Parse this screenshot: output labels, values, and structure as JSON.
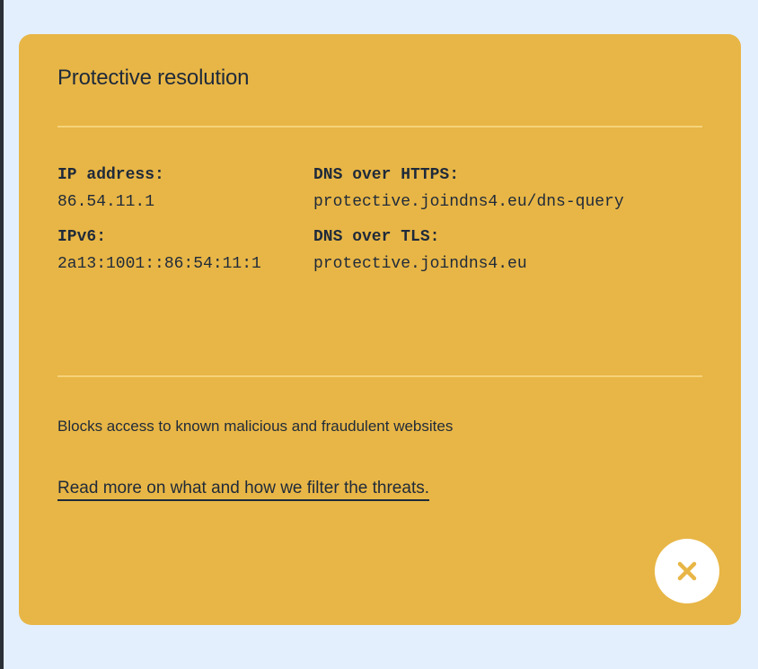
{
  "card": {
    "title": "Protective resolution",
    "info": {
      "ip_label": "IP address:",
      "ip_value": "86.54.11.1",
      "ipv6_label": "IPv6:",
      "ipv6_value": "2a13:1001::86:54:11:1",
      "doh_label": "DNS over HTTPS:",
      "doh_value": "protective.joindns4.eu/dns-query",
      "dot_label": "DNS over TLS:",
      "dot_value": "protective.joindns4.eu"
    },
    "description": "Blocks access to known malicious and fraudulent websites",
    "read_more_link": "Read more on what and how we filter the threats.",
    "close_icon": "close-icon"
  },
  "colors": {
    "page_background": "#e3effd",
    "card_background": "#e8b646",
    "divider": "#f5d37a",
    "text": "#1f2a3a",
    "close_button_background": "#ffffff",
    "close_icon": "#e8b646"
  }
}
